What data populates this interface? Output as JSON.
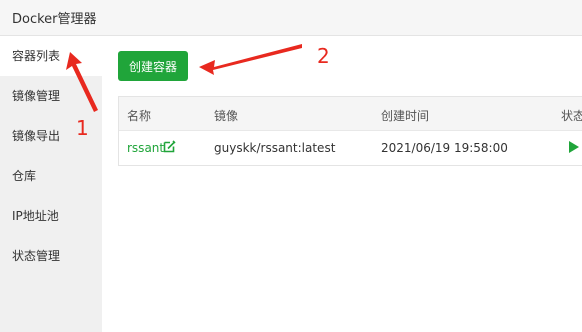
{
  "app": {
    "title": "Docker管理器"
  },
  "sidebar": {
    "items": [
      {
        "label": "容器列表"
      },
      {
        "label": "镜像管理"
      },
      {
        "label": "镜像导出"
      },
      {
        "label": "仓库"
      },
      {
        "label": "IP地址池"
      },
      {
        "label": "状态管理"
      }
    ]
  },
  "toolbar": {
    "create_label": "创建容器",
    "accent_color": "#20a53a"
  },
  "table": {
    "columns": [
      "名称",
      "镜像",
      "创建时间",
      "状态"
    ],
    "rows": [
      {
        "name": "rssant",
        "image": "guyskk/rssant:latest",
        "created": "2021/06/19 19:58:00",
        "status_icon": "play-icon"
      }
    ]
  },
  "annotations": {
    "label_1": "1",
    "label_2": "2",
    "color": "#e8291f"
  }
}
